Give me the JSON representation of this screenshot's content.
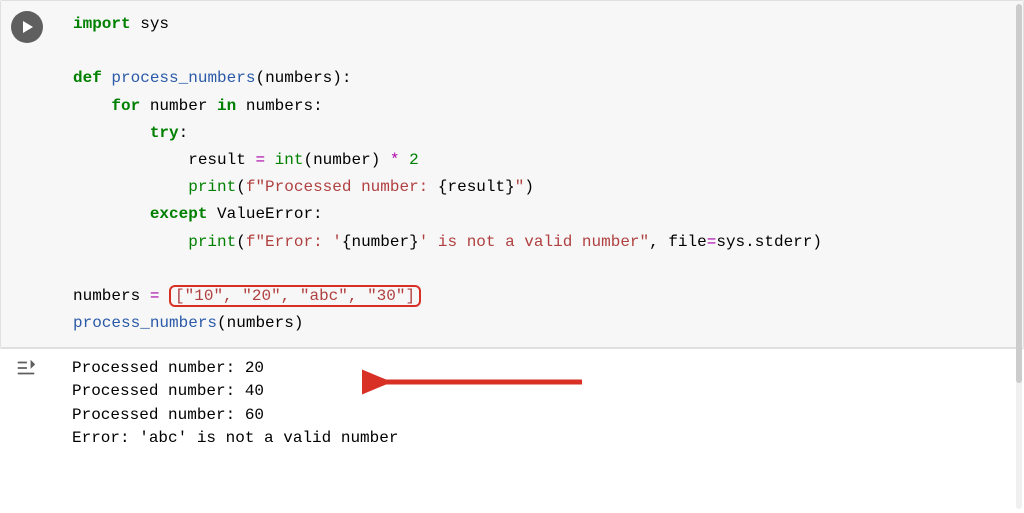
{
  "code": {
    "l1_import": "import",
    "l1_sys": "sys",
    "l3_def": "def",
    "l3_fn": "process_numbers",
    "l3_arg": "numbers",
    "l4_for": "for",
    "l4_var": "number",
    "l4_in": "in",
    "l4_iter": "numbers",
    "l5_try": "try",
    "l6_result": "result",
    "l6_eq": "=",
    "l6_int": "int",
    "l6_intarg": "number",
    "l6_star": "*",
    "l6_two": "2",
    "l7_print": "print",
    "l7_f": "f",
    "l7_str_a": "\"Processed number: ",
    "l7_interp": "{result}",
    "l7_str_b": "\"",
    "l8_except": "except",
    "l8_err": "ValueError",
    "l9_print": "print",
    "l9_f": "f",
    "l9_str_a": "\"Error: '",
    "l9_interp": "{number}",
    "l9_str_b": "' is not a valid number\"",
    "l9_filekw": "file",
    "l9_eq": "=",
    "l9_sys": "sys",
    "l9_stderr": "stderr",
    "l11_var": "numbers",
    "l11_eq": "=",
    "l11_list": "[\"10\", \"20\", \"abc\", \"30\"]",
    "l12_call": "process_numbers",
    "l12_arg": "numbers"
  },
  "output": {
    "line1": "Processed number: 20",
    "line2": "Processed number: 40",
    "line3": "Processed number: 60",
    "line4": "Error: 'abc' is not a valid number"
  },
  "colors": {
    "highlight_red": "#d93025",
    "code_bg": "#f7f7f7",
    "keyword": "#008000",
    "string": "#b04040",
    "function": "#2a5aa8",
    "operator": "#aa00aa"
  }
}
